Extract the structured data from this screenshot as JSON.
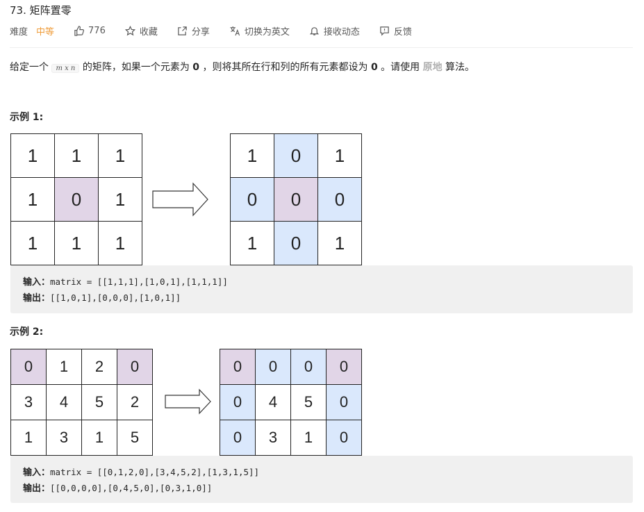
{
  "problem": {
    "title": "73. 矩阵置零",
    "difficulty_label": "难度",
    "difficulty": "中等",
    "likes": "776",
    "favorite": "收藏",
    "share": "分享",
    "switch_lang": "切换为英文",
    "subscribe": "接收动态",
    "feedback": "反馈"
  },
  "description": {
    "part1": "给定一个",
    "code": "m x n",
    "part2": "的矩阵，如果一个元素为",
    "zero1": "0",
    "part3": "，则将其所在行和列的所有元素都设为",
    "zero2": "0",
    "part4": "。请使用",
    "inplace": "原地",
    "part5": "算法。"
  },
  "example1": {
    "title": "示例 1:",
    "input_label": "输入：",
    "input_value": "matrix = [[1,1,1],[1,0,1],[1,1,1]]",
    "output_label": "输出：",
    "output_value": "[[1,0,1],[0,0,0],[1,0,1]]",
    "before": [
      [
        "1",
        "1",
        "1"
      ],
      [
        "1",
        "0",
        "1"
      ],
      [
        "1",
        "1",
        "1"
      ]
    ],
    "after": [
      [
        "1",
        "0",
        "1"
      ],
      [
        "0",
        "0",
        "0"
      ],
      [
        "1",
        "0",
        "1"
      ]
    ]
  },
  "example2": {
    "title": "示例 2:",
    "input_label": "输入：",
    "input_value": "matrix = [[0,1,2,0],[3,4,5,2],[1,3,1,5]]",
    "output_label": "输出：",
    "output_value": "[[0,0,0,0],[0,4,5,0],[0,3,1,0]]",
    "before": [
      [
        "0",
        "1",
        "2",
        "0"
      ],
      [
        "3",
        "4",
        "5",
        "2"
      ],
      [
        "1",
        "3",
        "1",
        "5"
      ]
    ],
    "after": [
      [
        "0",
        "0",
        "0",
        "0"
      ],
      [
        "0",
        "4",
        "5",
        "0"
      ],
      [
        "0",
        "3",
        "1",
        "0"
      ]
    ]
  },
  "colors": {
    "highlight_zero": "#e1d5e7",
    "affected": "#dae8fc",
    "difficulty": "#ef9c3a"
  }
}
